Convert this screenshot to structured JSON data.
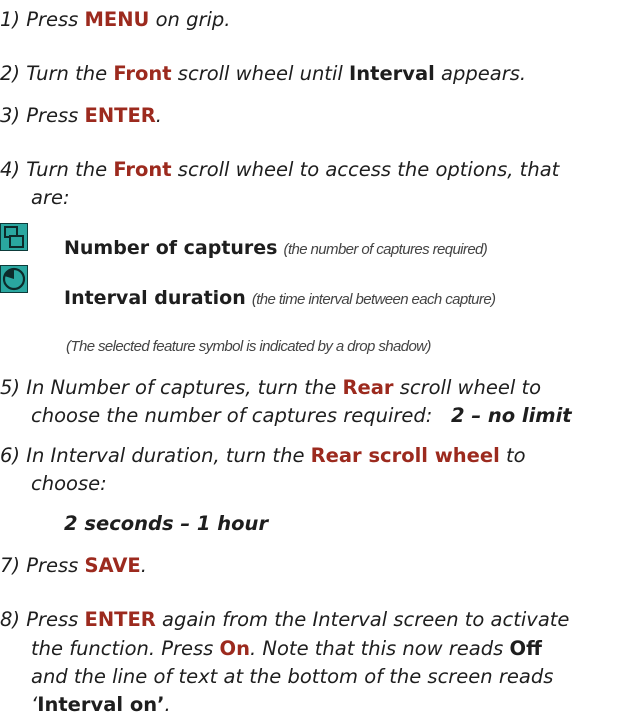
{
  "steps": [
    {
      "num": "1)",
      "a": "Press ",
      "b": "MENU",
      "c": " on grip."
    },
    {
      "num": "2)",
      "a": "Turn the ",
      "b": "Front",
      "c": " scroll wheel until ",
      "d": "Interval",
      "e": " appears."
    },
    {
      "num": "3)",
      "a": "Press ",
      "b": "ENTER",
      "c": "."
    },
    {
      "num": "4)",
      "a": "Turn the ",
      "b": "Front",
      "c": " scroll wheel to access the options, that",
      "cont": "are:"
    },
    {
      "num": "5)",
      "a": "In Number of captures, turn the ",
      "b": "Rear",
      "c": " scroll wheel to",
      "cont": "choose the number of captures required:",
      "range": "2 – no limit"
    },
    {
      "num": "6)",
      "a": "In Interval duration, turn the ",
      "b": "Rear scroll wheel",
      "c": " to",
      "cont": "choose:",
      "range": "2 seconds – 1 hour"
    },
    {
      "num": "7)",
      "a": "Press ",
      "b": "SAVE",
      "c": "."
    },
    {
      "num": "8)",
      "a": "Press ",
      "b": "ENTER",
      "c": " again from the Interval screen to activate",
      "l2a": "the function. Press ",
      "l2b": "On",
      "l2c": ". Note that this now reads ",
      "l2d": "Off",
      "l3": "and the line of text at the bottom of the screen reads",
      "l4a": "‘",
      "l4b": "Interval on’",
      "l4c": "."
    }
  ],
  "features": [
    {
      "icon": "captures-icon",
      "name": "Number of captures",
      "desc": "(the number of captures required)"
    },
    {
      "icon": "interval-clock-icon",
      "name": "Interval duration",
      "desc": "(the time interval between each capture)"
    }
  ],
  "note": "(The selected feature symbol is indicated by a drop shadow)",
  "colors": {
    "accent": "#9c2a1e",
    "icon_fill": "#2aa7a0",
    "text": "#1e1e1e"
  }
}
